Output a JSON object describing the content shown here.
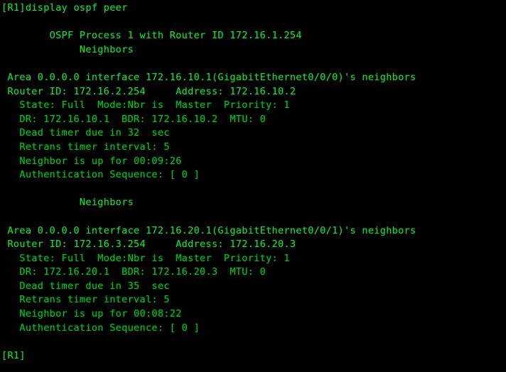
{
  "terminal": {
    "title": "display ospf peer",
    "foreground_color": "#00c020",
    "background_color": "#000000",
    "prompt": "[R1]",
    "command_line": "[R1]display ospf peer",
    "trailing_prompt": "[R1]",
    "header": {
      "process_line": "        OSPF Process 1 with Router ID 172.16.1.254",
      "neighbors_label": "             Neighbors"
    },
    "neighbor_blocks": [
      {
        "area_line": " Area 0.0.0.0 interface 172.16.10.1(GigabitEthernet0/0/0)'s neighbors",
        "router_id_line": " Router ID: 172.16.2.254     Address: 172.16.10.2",
        "state_line": "   State: Full  Mode:Nbr is  Master  Priority: 1",
        "dr_line": "   DR: 172.16.10.1  BDR: 172.16.10.2  MTU: 0",
        "dead_timer_line": "   Dead timer due in 32  sec",
        "retrans_line": "   Retrans timer interval: 5",
        "uptime_line": "   Neighbor is up for 00:09:26",
        "auth_line": "   Authentication Sequence: [ 0 ]",
        "fields": {
          "area": "0.0.0.0",
          "interface_ip": "172.16.10.1",
          "interface_name": "GigabitEthernet0/0/0",
          "router_id": "172.16.2.254",
          "address": "172.16.10.2",
          "state": "Full",
          "mode": "Nbr is  Master",
          "priority": "1",
          "dr": "172.16.10.1",
          "bdr": "172.16.10.2",
          "mtu": "0",
          "dead_timer": "32",
          "retrans_interval": "5",
          "uptime": "00:09:26",
          "auth_sequence": "[ 0 ]"
        }
      },
      {
        "neighbors_label": "             Neighbors",
        "area_line": " Area 0.0.0.0 interface 172.16.20.1(GigabitEthernet0/0/1)'s neighbors",
        "router_id_line": " Router ID: 172.16.3.254     Address: 172.16.20.3",
        "state_line": "   State: Full  Mode:Nbr is  Master  Priority: 1",
        "dr_line": "   DR: 172.16.20.1  BDR: 172.16.20.3  MTU: 0",
        "dead_timer_line": "   Dead timer due in 35  sec",
        "retrans_line": "   Retrans timer interval: 5",
        "uptime_line": "   Neighbor is up for 00:08:22",
        "auth_line": "   Authentication Sequence: [ 0 ]",
        "fields": {
          "area": "0.0.0.0",
          "interface_ip": "172.16.20.1",
          "interface_name": "GigabitEthernet0/0/1",
          "router_id": "172.16.3.254",
          "address": "172.16.20.3",
          "state": "Full",
          "mode": "Nbr is  Master",
          "priority": "1",
          "dr": "172.16.20.1",
          "bdr": "172.16.20.3",
          "mtu": "0",
          "dead_timer": "35",
          "retrans_interval": "5",
          "uptime": "00:08:22",
          "auth_sequence": "[ 0 ]"
        }
      }
    ],
    "blank": ""
  }
}
